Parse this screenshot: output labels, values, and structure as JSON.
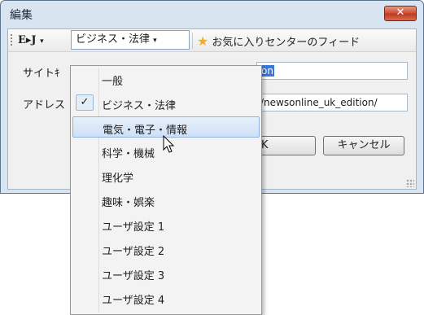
{
  "window": {
    "title": "編集",
    "close_glyph": "✕"
  },
  "toolbar": {
    "ej_label": "E▸J",
    "category_value": "ビジネス・法律",
    "favorites_label": "お気に入りセンターのフィード"
  },
  "form": {
    "site_label": "サイトｷ",
    "site_value": "on",
    "address_label": "アドレス",
    "address_value": "/newsonline_uk_edition/",
    "ok_label": "K",
    "cancel_label": "キャンセル"
  },
  "menu": {
    "items": [
      {
        "label": "一般",
        "checked": false
      },
      {
        "label": "ビジネス・法律",
        "checked": true
      },
      {
        "label": "電気・電子・情報",
        "checked": false,
        "highlighted": true
      },
      {
        "label": "科学・機械",
        "checked": false
      },
      {
        "label": "理化学",
        "checked": false
      },
      {
        "label": "趣味・娯楽",
        "checked": false
      },
      {
        "label": "ユーザ設定 1",
        "checked": false
      },
      {
        "label": "ユーザ設定 2",
        "checked": false
      },
      {
        "label": "ユーザ設定 3",
        "checked": false
      },
      {
        "label": "ユーザ設定 4",
        "checked": false
      }
    ],
    "check_glyph": "✓"
  }
}
